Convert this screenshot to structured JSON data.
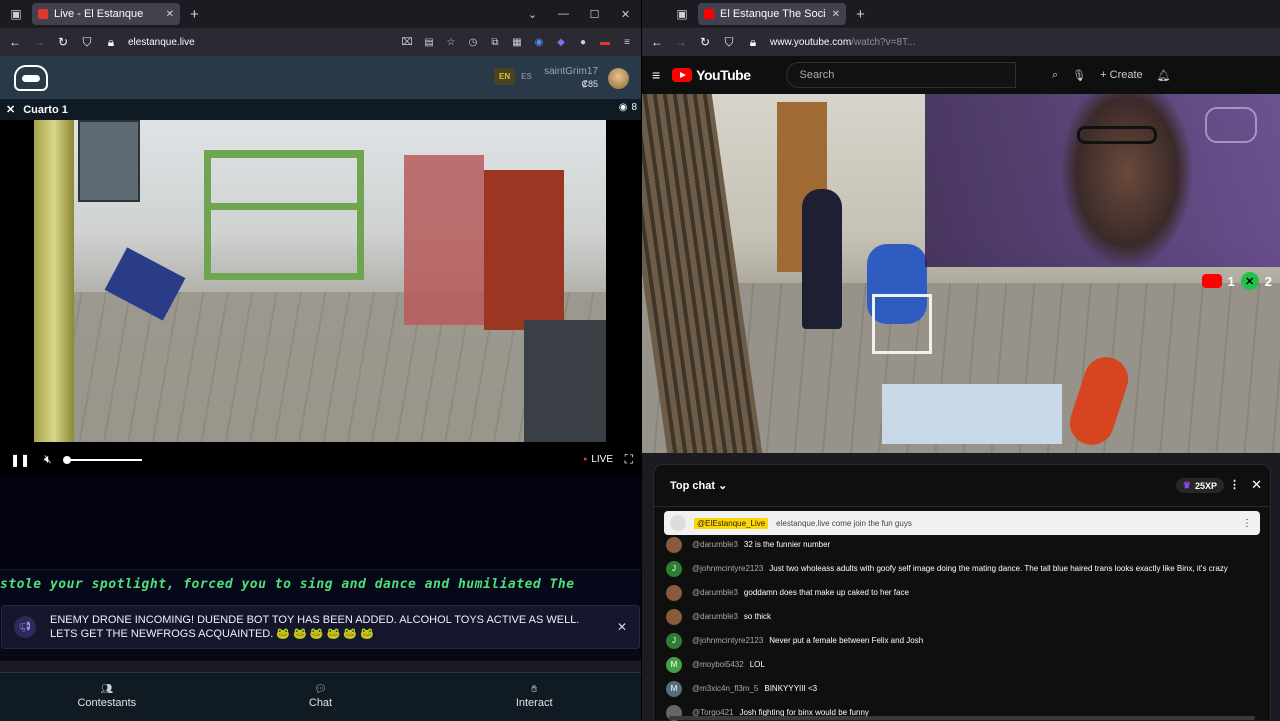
{
  "left": {
    "tab_title": "Live - El Estanque",
    "url": "elestanque.live",
    "lang_en": "EN",
    "lang_es": "ES",
    "username": "saintGrim17",
    "coins": "₡85",
    "room_name": "Cuarto 1",
    "viewers": "8",
    "live_label": "LIVE",
    "ticker": "stole your spotlight, forced you to sing and dance and humiliated The",
    "notice": "ENEMY DRONE INCOMING! DUENDE BOT TOY HAS BEEN ADDED. ALCOHOL TOYS ACTIVE AS WELL. LETS GET THE NEWFROGS ACQUAINTED. 🐸 🐸 🐸 🐸 🐸 🐸",
    "nav": [
      {
        "label": "Contestants",
        "icon": "people-icon"
      },
      {
        "label": "Chat",
        "icon": "chat-icon"
      },
      {
        "label": "Interact",
        "icon": "interact-icon"
      }
    ]
  },
  "right": {
    "tab_title": "El Estanque The Social Expe",
    "url_host": "www.youtube.com",
    "url_rest": "/watch?v=8T...",
    "yt_logo": "YouTube",
    "search_placeholder": "Search",
    "create_label": "Create",
    "counter_yt": "1",
    "counter_x": "2",
    "chat": {
      "title": "Top chat",
      "xp": "25XP",
      "pinned_name": "@ElEstanque_Live",
      "pinned_text": "elestanque.live come join the fun guys",
      "messages": [
        {
          "user": "@darumble3",
          "text": "32 is the funnier number",
          "initial": "",
          "color": "#8a5a3c"
        },
        {
          "user": "@johnmcintyre2123",
          "text": "Just two wholeass adults with goofy self image doing the mating dance. The tall blue haired trans looks exactly like Binx, it's crazy",
          "initial": "J",
          "color": "#2e7d32"
        },
        {
          "user": "@darumble3",
          "text": "goddamn does that make up caked to her face",
          "initial": "",
          "color": "#8a5a3c"
        },
        {
          "user": "@darumble3",
          "text": "so thick",
          "initial": "",
          "color": "#8a5a3c"
        },
        {
          "user": "@johnmcintyre2123",
          "text": "Never put a female between Felix and Josh",
          "initial": "J",
          "color": "#2e7d32"
        },
        {
          "user": "@moyboi5432",
          "text": "LOL",
          "initial": "M",
          "color": "#43a047"
        },
        {
          "user": "@m3xic4n_fl3m_5",
          "text": "BINKYYYIII <3",
          "initial": "M",
          "color": "#546e7a"
        },
        {
          "user": "@Torgo421",
          "text": "Josh fighting for binx would be funny",
          "initial": "",
          "color": "#666666"
        }
      ]
    }
  },
  "colors": {
    "accent_green": "#4de07a",
    "yt_red": "#ff0000",
    "live_red": "#e2372b"
  }
}
